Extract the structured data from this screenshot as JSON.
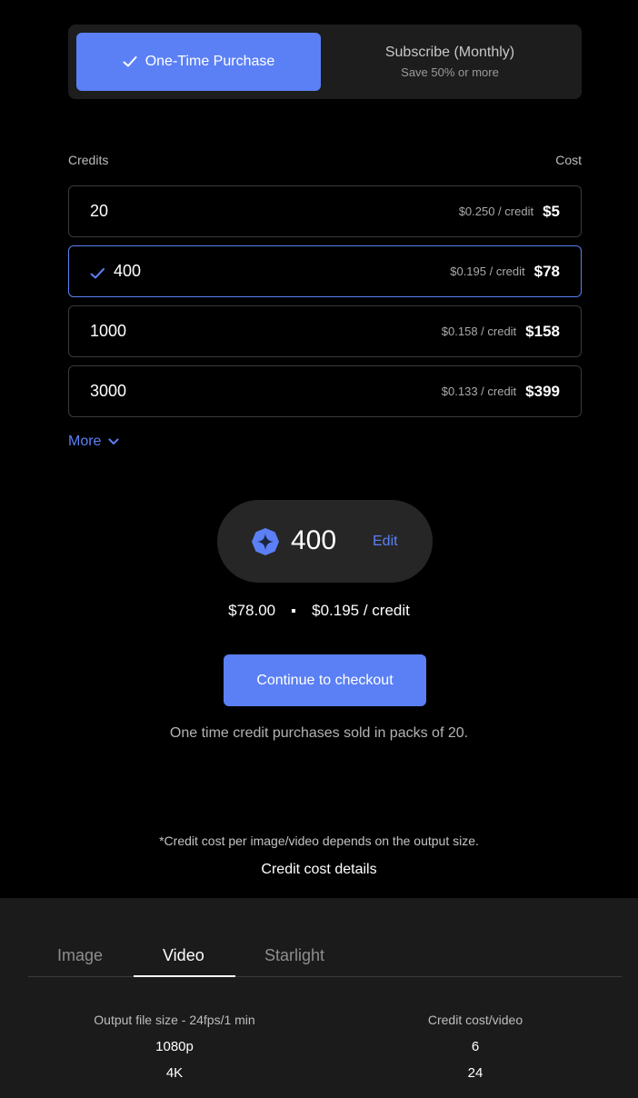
{
  "purchase_toggle": {
    "one_time_label": "One-Time Purchase",
    "subscribe_label": "Subscribe (Monthly)",
    "subscribe_sub": "Save 50% or more"
  },
  "headers": {
    "credits": "Credits",
    "cost": "Cost"
  },
  "packs": [
    {
      "credits": "20",
      "per_credit": "$0.250 / credit",
      "price": "$5",
      "selected": false
    },
    {
      "credits": "400",
      "per_credit": "$0.195 / credit",
      "price": "$78",
      "selected": true
    },
    {
      "credits": "1000",
      "per_credit": "$0.158 / credit",
      "price": "$158",
      "selected": false
    },
    {
      "credits": "3000",
      "per_credit": "$0.133 / credit",
      "price": "$399",
      "selected": false
    }
  ],
  "more_label": "More",
  "summary": {
    "amount": "400",
    "edit_label": "Edit",
    "total": "$78.00",
    "per_credit": "$0.195 / credit"
  },
  "checkout_label": "Continue to checkout",
  "note": "One time credit purchases sold in packs of 20.",
  "footnote": "*Credit cost per image/video depends on the output size.",
  "details_link": "Credit cost details",
  "cost_tabs": {
    "tabs": [
      "Image",
      "Video",
      "Starlight"
    ],
    "active": "Video",
    "table": {
      "headers": [
        "Output file size - 24fps/1 min",
        "Credit cost/video"
      ],
      "rows": [
        [
          "1080p",
          "6"
        ],
        [
          "4K",
          "24"
        ]
      ]
    }
  },
  "colors": {
    "accent": "#5b80f5",
    "background": "#000000",
    "panel": "#1b1b1b"
  }
}
